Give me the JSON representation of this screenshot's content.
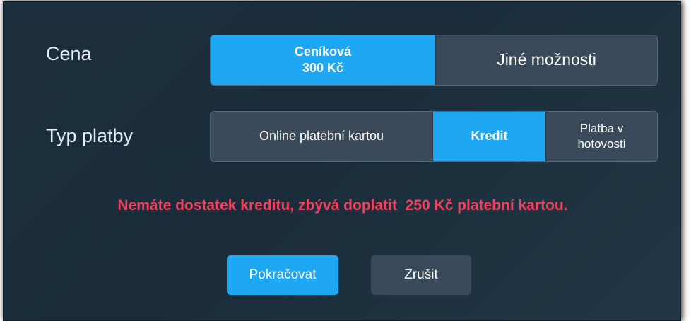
{
  "colors": {
    "accent": "#1ea7f3",
    "inactive": "#3b4a5a",
    "warning": "#f2405e",
    "background": "#1c2f3d"
  },
  "price": {
    "label": "Cena",
    "options": [
      {
        "line1": "Ceníková",
        "line2": "300 Kč",
        "selected": true
      },
      {
        "line1": "Jiné možnosti",
        "line2": "",
        "selected": false
      }
    ]
  },
  "payment_type": {
    "label": "Typ platby",
    "options": [
      {
        "line1": "Online platební kartou",
        "line2": "",
        "selected": false
      },
      {
        "line1": "Kredit",
        "line2": "",
        "selected": true
      },
      {
        "line1": "Platba v",
        "line2": "hotovosti",
        "selected": false
      }
    ]
  },
  "warning": "Nemáte dostatek kreditu, zbývá doplatit  250 Kč platební kartou.",
  "buttons": {
    "continue": "Pokračovat",
    "cancel": "Zrušit"
  }
}
